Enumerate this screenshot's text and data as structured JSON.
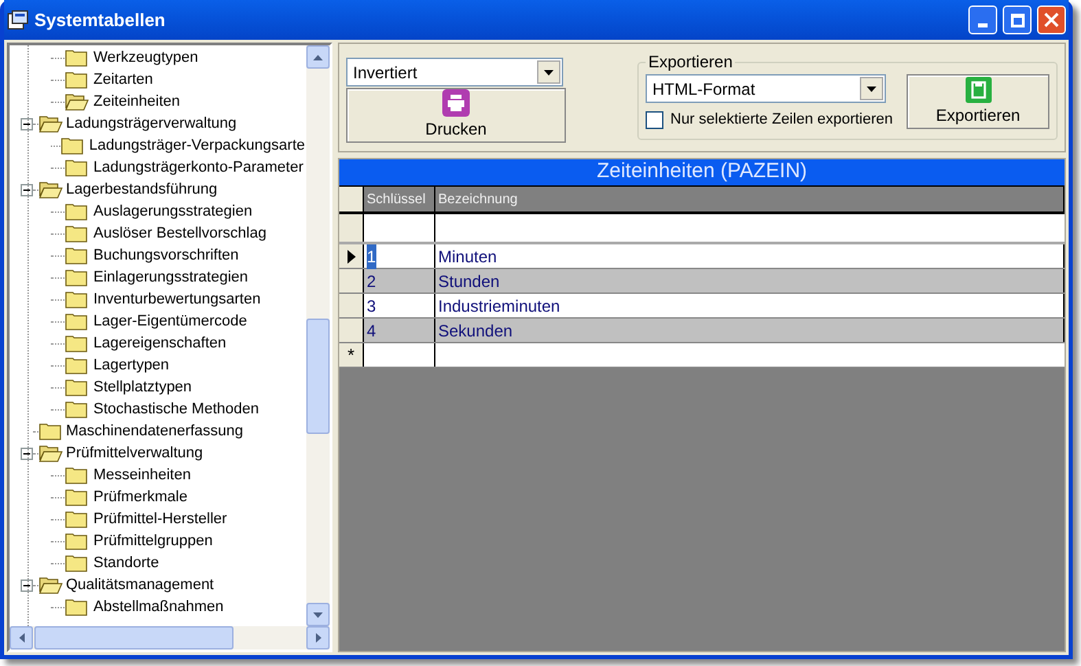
{
  "window": {
    "title": "Systemtabellen"
  },
  "tree": {
    "leading_children": [
      {
        "label": "Werkzeugtypen",
        "selected": false
      },
      {
        "label": "Zeitarten",
        "selected": false
      },
      {
        "label": "Zeiteinheiten",
        "selected": true
      }
    ],
    "items": [
      {
        "label": "Ladungsträgerverwaltung",
        "expanded": true,
        "children": [
          {
            "label": "Ladungsträger-Verpackungsarte",
            "selected": false
          },
          {
            "label": "Ladungsträgerkonto-Parameter",
            "selected": false
          }
        ]
      },
      {
        "label": "Lagerbestandsführung",
        "expanded": true,
        "children": [
          {
            "label": "Auslagerungsstrategien",
            "selected": false
          },
          {
            "label": "Auslöser Bestellvorschlag",
            "selected": false
          },
          {
            "label": "Buchungsvorschriften",
            "selected": false
          },
          {
            "label": "Einlagerungsstrategien",
            "selected": false
          },
          {
            "label": "Inventurbewertungsarten",
            "selected": false
          },
          {
            "label": "Lager-Eigentümercode",
            "selected": false
          },
          {
            "label": "Lagereigenschaften",
            "selected": false
          },
          {
            "label": "Lagertypen",
            "selected": false
          },
          {
            "label": "Stellplatztypen",
            "selected": false
          },
          {
            "label": "Stochastische Methoden",
            "selected": false
          }
        ]
      },
      {
        "label": "Maschinendatenerfassung",
        "expanded": false
      },
      {
        "label": "Prüfmittelverwaltung",
        "expanded": true,
        "children": [
          {
            "label": "Messeinheiten",
            "selected": false
          },
          {
            "label": "Prüfmerkmale",
            "selected": false
          },
          {
            "label": "Prüfmittel-Hersteller",
            "selected": false
          },
          {
            "label": "Prüfmittelgruppen",
            "selected": false
          },
          {
            "label": "Standorte",
            "selected": false
          }
        ]
      },
      {
        "label": "Qualitätsmanagement",
        "expanded": true,
        "children": [
          {
            "label": "Abstellmaßnahmen",
            "selected": false
          }
        ]
      }
    ]
  },
  "print": {
    "mode": "Invertiert",
    "button": "Drucken"
  },
  "export": {
    "legend": "Exportieren",
    "format": "HTML-Format",
    "only_selected": {
      "label": "Nur selektierte Zeilen exportieren",
      "checked": false
    },
    "button": "Exportieren"
  },
  "grid": {
    "caption": "Zeiteinheiten (PAZEIN)",
    "columns": [
      "Schlüssel",
      "Bezeichnung"
    ],
    "new_row_marker": "*",
    "rows": [
      {
        "cells": [
          "1",
          "Minuten"
        ],
        "current": true
      },
      {
        "cells": [
          "2",
          "Stunden"
        ],
        "current": false
      },
      {
        "cells": [
          "3",
          "Industrieminuten"
        ],
        "current": false
      },
      {
        "cells": [
          "4",
          "Sekunden"
        ],
        "current": false
      }
    ]
  }
}
